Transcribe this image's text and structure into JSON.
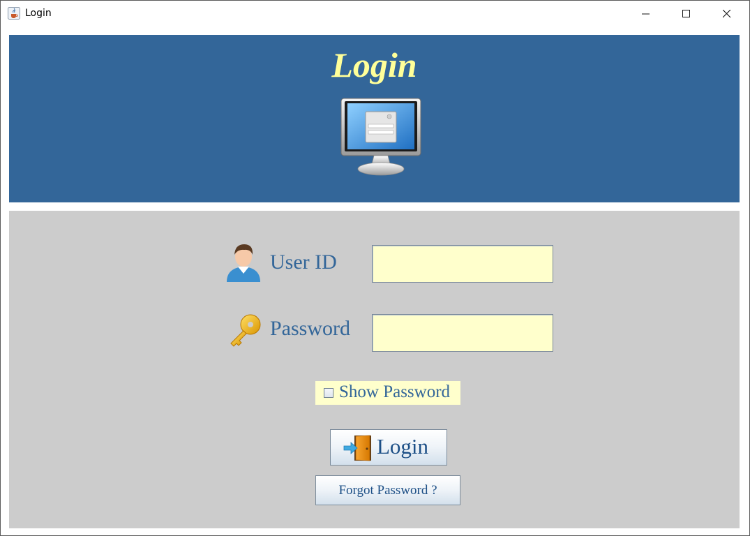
{
  "window": {
    "title": "Login",
    "icon": "java-cup-icon",
    "controls": [
      "minimize-icon",
      "maximize-icon",
      "close-icon"
    ]
  },
  "header": {
    "title": "Login",
    "icon": "monitor-login-icon",
    "background": "#336699",
    "title_color": "#ffff99"
  },
  "form": {
    "user_id_label": "User ID",
    "user_id_icon": "user-avatar-icon",
    "user_id_value": "",
    "password_label": "Password",
    "password_icon": "key-icon",
    "password_value": "",
    "field_background": "#ffffcc",
    "show_password_label": "Show Password",
    "show_password_checked": false,
    "login_button_label": "Login",
    "login_button_icon": "door-enter-icon",
    "forgot_button_label": "Forgot Password ?"
  },
  "colors": {
    "panel_background": "#cccccc",
    "label_color": "#336699"
  }
}
